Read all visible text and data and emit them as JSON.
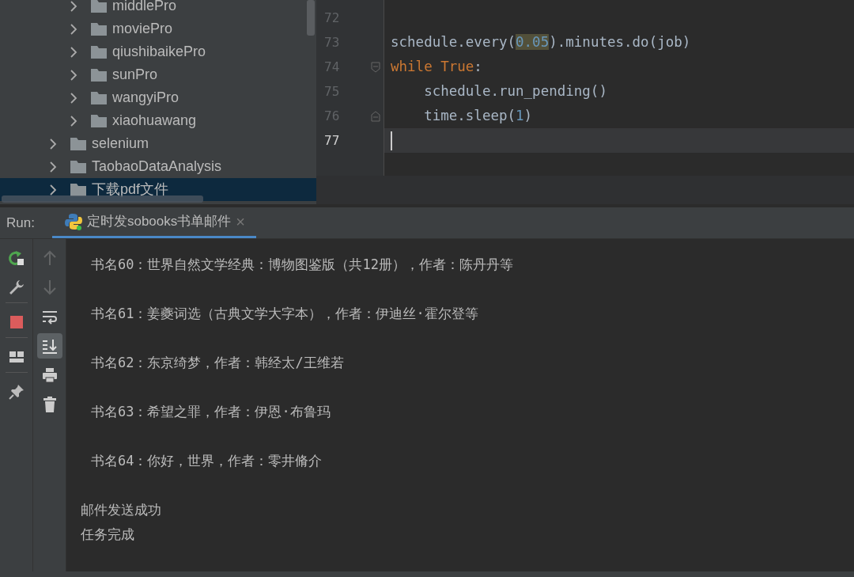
{
  "project_tree": {
    "items": [
      {
        "children": [
          {
            "label": "middlePro",
            "expanded": false,
            "selected": false
          },
          {
            "label": "moviePro",
            "expanded": false,
            "selected": false
          },
          {
            "label": "qiushibaikePro",
            "expanded": false,
            "selected": false
          },
          {
            "label": "sunPro",
            "expanded": false,
            "selected": false
          },
          {
            "label": "wangyiPro",
            "expanded": false,
            "selected": false
          },
          {
            "label": "xiaohuawang",
            "expanded": false,
            "selected": false
          }
        ]
      },
      {
        "label": "selenium",
        "expanded": false,
        "selected": false
      },
      {
        "label": "TaobaoDataAnalysis",
        "expanded": false,
        "selected": false
      },
      {
        "label": "下载pdf文件",
        "expanded": false,
        "selected": true
      }
    ]
  },
  "editor": {
    "lines": [
      {
        "number": "72",
        "current": false
      },
      {
        "number": "73",
        "current": false,
        "tokens": [
          {
            "text": "schedule.every(",
            "kind": "plain"
          },
          {
            "text": "0.05",
            "kind": "number",
            "highlighted": true
          },
          {
            "text": ").minutes.do(job)",
            "kind": "plain"
          }
        ]
      },
      {
        "number": "74",
        "current": false,
        "fold_start": true,
        "tokens": [
          {
            "text": "while True",
            "kind": "keyword"
          },
          {
            "text": ":",
            "kind": "plain"
          }
        ]
      },
      {
        "number": "75",
        "current": false,
        "tokens": [
          {
            "text": "    schedule.run_pending()",
            "kind": "plain"
          }
        ]
      },
      {
        "number": "76",
        "current": false,
        "fold_end": true,
        "tokens": [
          {
            "text": "    time.sleep(",
            "kind": "plain"
          },
          {
            "text": "1",
            "kind": "number"
          },
          {
            "text": ")",
            "kind": "plain"
          }
        ]
      },
      {
        "number": "77",
        "current": true
      }
    ]
  },
  "run_bar": {
    "label": "Run:",
    "tabs": [
      {
        "title": "定时发sobooks书单邮件",
        "selected": true,
        "close": "×"
      }
    ]
  },
  "console_toolbar": {
    "left": [
      {
        "kind": "rerun"
      },
      {
        "kind": "settings"
      },
      {
        "kind": "stop"
      },
      {
        "kind": "layout"
      },
      {
        "kind": "pin"
      }
    ],
    "right": [
      {
        "kind": "up",
        "disabled": true,
        "selected": false
      },
      {
        "kind": "down",
        "disabled": true,
        "selected": false
      },
      {
        "kind": "wrap",
        "disabled": false,
        "selected": false
      },
      {
        "kind": "scroll-end",
        "disabled": false,
        "selected": true
      },
      {
        "kind": "print",
        "disabled": false,
        "selected": false
      },
      {
        "kind": "trash",
        "disabled": false,
        "selected": false
      }
    ]
  },
  "console": {
    "lines": [
      {
        "kind": "book",
        "text": "书名60：世界自然文学经典：博物图鉴版（共12册），作者：陈丹丹等"
      },
      {
        "kind": "book",
        "text": "书名61：姜夔词选（古典文学大字本），作者：伊迪丝·霍尔登等"
      },
      {
        "kind": "book",
        "text": "书名62：东京绮梦，作者：韩经太/王维若"
      },
      {
        "kind": "book",
        "text": "书名63：希望之罪，作者：伊恩·布鲁玛"
      },
      {
        "kind": "book",
        "text": "书名64：你好，世界，作者：零井脩介"
      },
      {
        "kind": "message",
        "text": "邮件发送成功"
      },
      {
        "kind": "message",
        "text": "任务完成"
      }
    ]
  }
}
